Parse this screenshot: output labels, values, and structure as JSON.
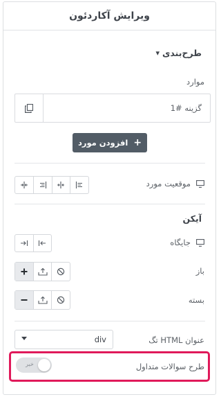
{
  "header": {
    "title": "ویرایش آکاردئون"
  },
  "section_layout": {
    "title": "طرح‌بندی",
    "caret": "▾"
  },
  "items": {
    "label": "موارد",
    "item_text": "گزینه #1",
    "add_button_label": "افزودن مورد",
    "add_icon": "+"
  },
  "item_position": {
    "label": "موقعیت مورد"
  },
  "icon_section": {
    "title": "آیکن",
    "position_label": "جایگاه",
    "open_label": "باز",
    "closed_label": "بسته"
  },
  "title_html_tag": {
    "label": "تگ HTML عنوان",
    "value": "div"
  },
  "faq_schema": {
    "label": "طرح سوالات متداول",
    "toggle_text": "خیر",
    "enabled": false
  },
  "colors": {
    "highlight": "#e0195a",
    "button": "#525c66"
  }
}
